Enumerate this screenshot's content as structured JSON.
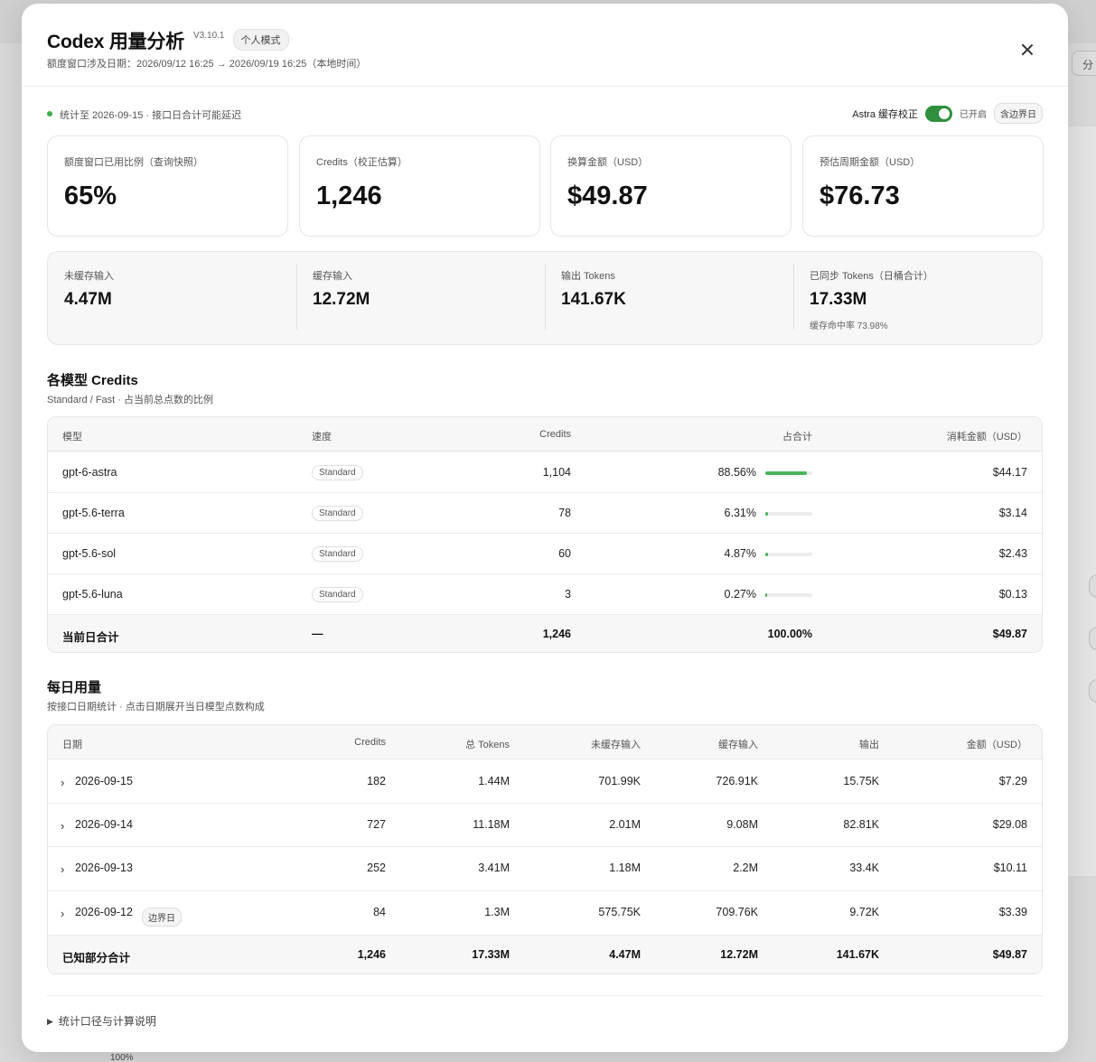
{
  "background": {
    "chip_label": "分",
    "percent_label": "100%"
  },
  "header": {
    "title": "Codex 用量分析",
    "version": "V3.10.1",
    "mode_badge": "个人模式",
    "subtitle": "额度窗口涉及日期：2026/09/12 16:25 → 2026/09/19 16:25（本地时间）",
    "close_icon": "close-icon"
  },
  "status": {
    "text": "统计至 2026-09-15 · 接口日合计可能延迟",
    "dot_color": "#3fae4f",
    "toggle_label": "Astra 缓存校正",
    "toggle_on": true,
    "toggle_state": "已开启",
    "boundary_chip": "含边界日"
  },
  "cards": [
    {
      "label": "额度窗口已用比例（查询快照）",
      "value": "65%"
    },
    {
      "label": "Credits（校正估算）",
      "value": "1,246"
    },
    {
      "label": "换算金额（USD）",
      "value": "$49.87"
    },
    {
      "label": "预估周期金额（USD）",
      "value": "$76.73"
    }
  ],
  "stats": [
    {
      "label": "未缓存输入",
      "value": "4.47M",
      "sub": ""
    },
    {
      "label": "缓存输入",
      "value": "12.72M",
      "sub": ""
    },
    {
      "label": "输出 Tokens",
      "value": "141.67K",
      "sub": ""
    },
    {
      "label": "已同步 Tokens（日桶合计）",
      "value": "17.33M",
      "sub": "缓存命中率 73.98%"
    }
  ],
  "models_section": {
    "title": "各模型 Credits",
    "subtitle": "Standard / Fast · 占当前总点数的比例",
    "headers": {
      "model": "模型",
      "speed": "速度",
      "credits": "Credits",
      "share": "占合计",
      "cost": "消耗金额（USD）"
    },
    "rows": [
      {
        "model": "gpt-6-astra",
        "speed": "Standard",
        "credits": "1,104",
        "share": "88.56%",
        "share_value": 88.56,
        "cost": "$44.17"
      },
      {
        "model": "gpt-5.6-terra",
        "speed": "Standard",
        "credits": "78",
        "share": "6.31%",
        "share_value": 6.31,
        "cost": "$3.14"
      },
      {
        "model": "gpt-5.6-sol",
        "speed": "Standard",
        "credits": "60",
        "share": "4.87%",
        "share_value": 4.87,
        "cost": "$2.43"
      },
      {
        "model": "gpt-5.6-luna",
        "speed": "Standard",
        "credits": "3",
        "share": "0.27%",
        "share_value": 0.27,
        "cost": "$0.13"
      }
    ],
    "total": {
      "label": "当前日合计",
      "speed": "—",
      "credits": "1,246",
      "share": "100.00%",
      "cost": "$49.87"
    },
    "bar_color": "#4cb35e"
  },
  "daily_section": {
    "title": "每日用量",
    "subtitle": "按接口日期统计 · 点击日期展开当日模型点数构成",
    "headers": {
      "date": "日期",
      "credits": "Credits",
      "tokens": "总 Tokens",
      "uncached": "未缓存输入",
      "cached": "缓存输入",
      "output": "输出",
      "amount": "金额（USD）"
    },
    "rows": [
      {
        "date": "2026-09-15",
        "tag": "",
        "credits": "182",
        "tokens": "1.44M",
        "uncached": "701.99K",
        "cached": "726.91K",
        "output": "15.75K",
        "amount": "$7.29"
      },
      {
        "date": "2026-09-14",
        "tag": "",
        "credits": "727",
        "tokens": "11.18M",
        "uncached": "2.01M",
        "cached": "9.08M",
        "output": "82.81K",
        "amount": "$29.08"
      },
      {
        "date": "2026-09-13",
        "tag": "",
        "credits": "252",
        "tokens": "3.41M",
        "uncached": "1.18M",
        "cached": "2.2M",
        "output": "33.4K",
        "amount": "$10.11"
      },
      {
        "date": "2026-09-12",
        "tag": "边界日",
        "credits": "84",
        "tokens": "1.3M",
        "uncached": "575.75K",
        "cached": "709.76K",
        "output": "9.72K",
        "amount": "$3.39"
      }
    ],
    "total": {
      "label": "已知部分合计",
      "credits": "1,246",
      "tokens": "17.33M",
      "uncached": "4.47M",
      "cached": "12.72M",
      "output": "141.67K",
      "amount": "$49.87"
    }
  },
  "footer": {
    "toggle_label": "统计口径与计算说明",
    "arrow_icon": "triangle-right-icon"
  }
}
